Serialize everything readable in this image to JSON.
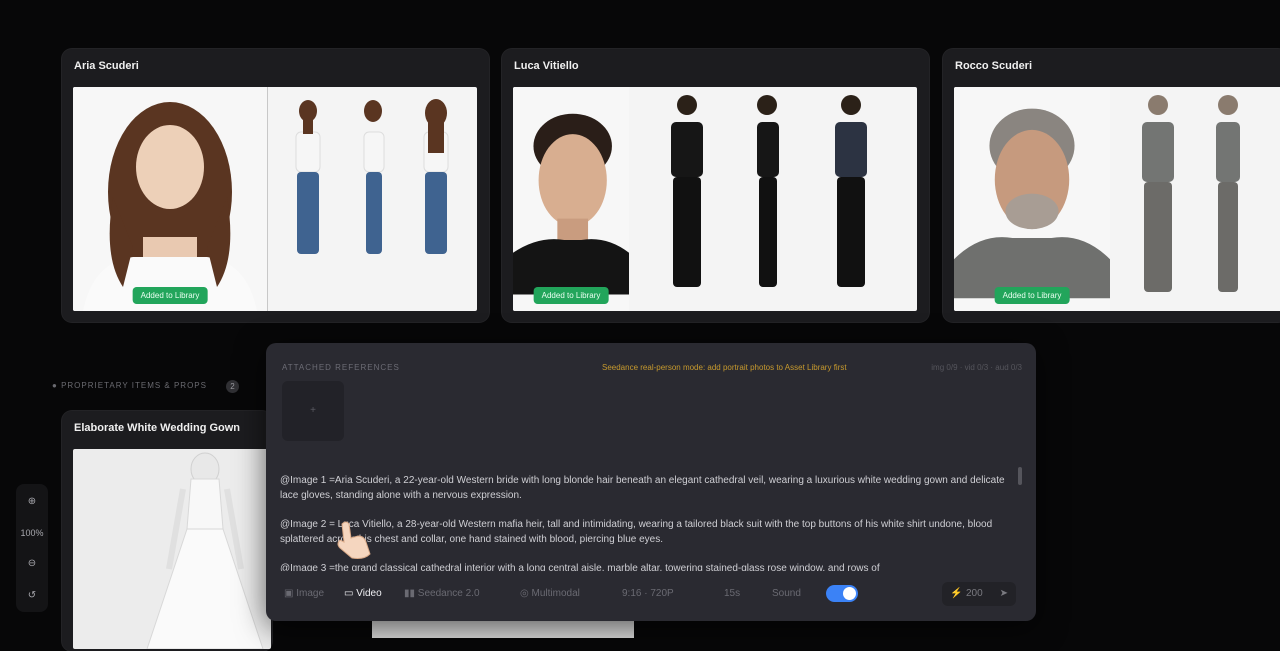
{
  "cards": [
    {
      "title": "Aria Scuderi",
      "badge": "Added to Library"
    },
    {
      "title": "Luca Vitiello",
      "badge": "Added to Library"
    },
    {
      "title": "Rocco Scuderi",
      "badge": "Added to Library"
    },
    {
      "title": "Elaborate White Wedding Gown"
    }
  ],
  "section": {
    "label": "PROPRIETARY ITEMS & PROPS",
    "count": "2"
  },
  "zoom": {
    "level": "100%"
  },
  "panel": {
    "header": "ATTACHED REFERENCES",
    "warning": "Seedance real-person mode: add portrait photos to Asset Library first",
    "meta": "img 0/9 · vid 0/3 · aud 0/3",
    "thumb_icon": "+",
    "prompt_paragraphs": [
      "@Image 1 =Aria Scuderi, a 22-year-old Western bride with long blonde hair beneath an elegant cathedral veil, wearing a luxurious white wedding gown and delicate lace gloves, standing alone with a nervous expression.",
      "@Image 2 = Luca Vitiello, a 28-year-old Western mafia heir, tall and intimidating, wearing a tailored black suit with the top buttons of his white shirt undone, blood splattered across his chest and collar, one hand stained with blood, piercing blue eyes.",
      "@Image 3 =the grand classical cathedral interior with a long central aisle, marble altar, towering stained-glass rose window, and rows of"
    ],
    "toolbar": {
      "image": "Image",
      "video": "Video",
      "model": "Seedance 2.0",
      "mode": "Multimodal",
      "ratio": "9:16 · 720P",
      "duration": "15s",
      "sound": "Sound",
      "credits": "200"
    }
  },
  "colors": {
    "accent": "#3b82f6",
    "badge": "#22a55b",
    "warning": "#c79a2e"
  },
  "icons": [
    "zoom-in-icon",
    "zoom-out-icon",
    "reset-icon",
    "image-icon",
    "video-icon",
    "model-icon",
    "multimodal-icon",
    "lightning-icon",
    "send-icon"
  ]
}
